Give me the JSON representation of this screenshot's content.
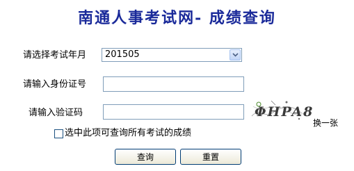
{
  "header": {
    "title": "南通人事考试网- 成绩查询"
  },
  "form": {
    "exam_month": {
      "label": "请选择考试年月",
      "selected": "201505"
    },
    "id_number": {
      "label": "请输入身份证号",
      "value": ""
    },
    "captcha": {
      "label": "请输入验证码",
      "value": "",
      "image_text": "ΦHPA8",
      "refresh_label": "换一张"
    },
    "all_exams": {
      "label": "选中此项可查询所有考试的成绩",
      "checked": false
    }
  },
  "buttons": {
    "query_label": "查询",
    "reset_label": "重置"
  },
  "colors": {
    "title": "#1a2a9a",
    "border": "#7f9db9",
    "captcha_ink": "#3a3a3a",
    "captcha_accent": "#4a8a2a"
  }
}
